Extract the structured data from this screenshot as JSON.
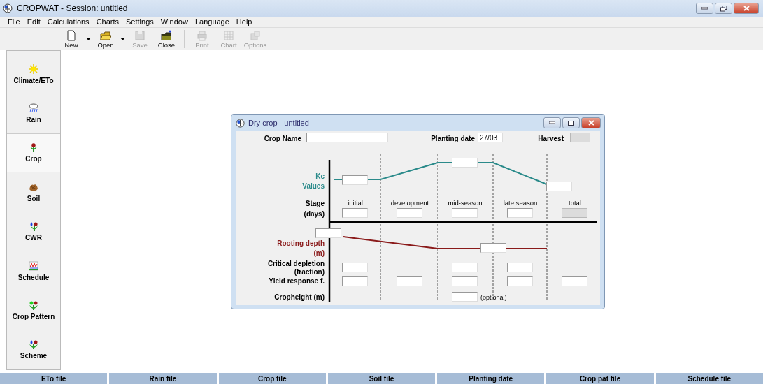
{
  "window": {
    "title": "CROPWAT - Session: untitled"
  },
  "menu": [
    "File",
    "Edit",
    "Calculations",
    "Charts",
    "Settings",
    "Window",
    "Language",
    "Help"
  ],
  "toolbar": [
    {
      "label": "New",
      "disabled": false,
      "dropdown": true
    },
    {
      "label": "Open",
      "disabled": false,
      "dropdown": true
    },
    {
      "label": "Save",
      "disabled": true,
      "dropdown": false
    },
    {
      "label": "Close",
      "disabled": false,
      "dropdown": false
    },
    {
      "label": "Print",
      "disabled": true,
      "dropdown": false
    },
    {
      "label": "Chart",
      "disabled": true,
      "dropdown": false
    },
    {
      "label": "Options",
      "disabled": true,
      "dropdown": false
    }
  ],
  "sidebar": [
    {
      "label": "Climate/ETo",
      "selected": false
    },
    {
      "label": "Rain",
      "selected": false
    },
    {
      "label": "Crop",
      "selected": true
    },
    {
      "label": "Soil",
      "selected": false
    },
    {
      "label": "CWR",
      "selected": false
    },
    {
      "label": "Schedule",
      "selected": false
    },
    {
      "label": "Crop Pattern",
      "selected": false
    },
    {
      "label": "Scheme",
      "selected": false
    }
  ],
  "dialog": {
    "title": "Dry crop - untitled",
    "crop_name": {
      "label": "Crop Name"
    },
    "planting_date": {
      "label": "Planting date",
      "value": "27/03"
    },
    "harvest": {
      "label": "Harvest",
      "disabled": true
    },
    "kc_label": [
      "Kc",
      "Values"
    ],
    "stage_label": [
      "Stage",
      "(days)"
    ],
    "stages": [
      {
        "name": "initial",
        "disabled": false
      },
      {
        "name": "development",
        "disabled": false
      },
      {
        "name": "mid-season",
        "disabled": false
      },
      {
        "name": "late season",
        "disabled": false
      },
      {
        "name": "total",
        "disabled": true
      }
    ],
    "rooting_label": [
      "Rooting depth",
      "(m)"
    ],
    "critical_label": [
      "Critical depletion",
      "(fraction)"
    ],
    "yield_label": "Yield response f.",
    "cropheight_label": "Cropheight (m)",
    "cropheight_note": "(optional)"
  },
  "status_bar": [
    "ETo file",
    "Rain file",
    "Crop file",
    "Soil file",
    "Planting date",
    "Crop pat file",
    "Schedule file"
  ]
}
